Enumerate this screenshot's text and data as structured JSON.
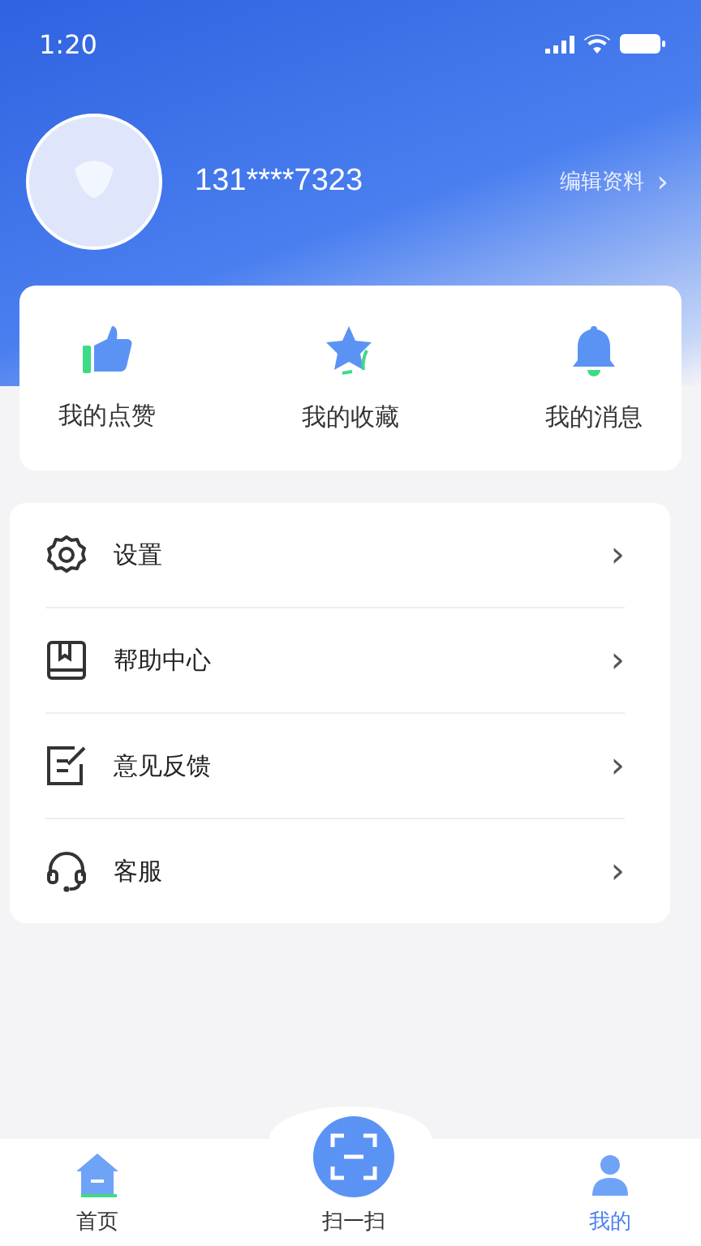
{
  "status_bar": {
    "time": "1:20"
  },
  "profile": {
    "phone": "131****7323",
    "edit_link": "编辑资料",
    "edit_chevron": "›"
  },
  "shortcuts": [
    {
      "kind": "like",
      "label": "我的点赞"
    },
    {
      "kind": "star",
      "label": "我的收藏"
    },
    {
      "kind": "bell",
      "label": "我的消息"
    }
  ],
  "menu": [
    {
      "kind": "settings",
      "label": "设置",
      "chevron": "›"
    },
    {
      "kind": "help",
      "label": "帮助中心",
      "chevron": "›"
    },
    {
      "kind": "feedback",
      "label": "意见反馈",
      "chevron": "›"
    },
    {
      "kind": "service",
      "label": "客服",
      "chevron": "›"
    }
  ],
  "tab_bar": [
    {
      "kind": "home",
      "label": "首页",
      "selected": false
    },
    {
      "kind": "scan",
      "label": "扫一扫",
      "selected": false
    },
    {
      "kind": "me",
      "label": "我的",
      "selected": true
    }
  ]
}
